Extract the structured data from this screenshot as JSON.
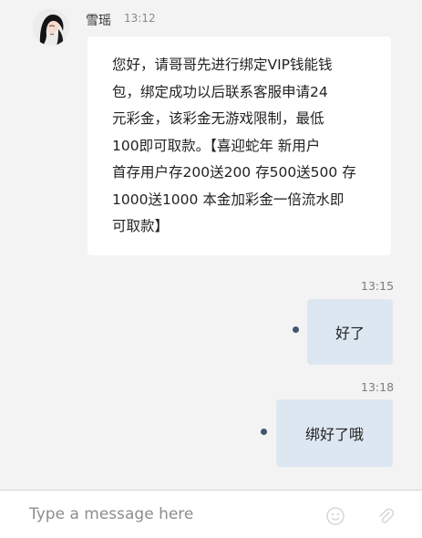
{
  "chat": {
    "incoming": {
      "sender_name": "雪瑶",
      "time": "13:12",
      "text": "您好，请哥哥先进行绑定VIP钱能钱\n包，绑定成功以后联系客服申请24\n元彩金，该彩金无游戏限制，最低\n100即可取款。【喜迎蛇年 新用户\n首存用户存200送200 存500送500 存\n1000送1000 本金加彩金一倍流水即\n可取款】"
    },
    "outgoing": [
      {
        "time": "13:15",
        "text": "好了"
      },
      {
        "time": "13:18",
        "text": "绑好了哦"
      }
    ]
  },
  "composer": {
    "placeholder": "Type a message here"
  },
  "icons": {
    "avatar": "user-avatar",
    "status_dot": "sent-indicator-dot",
    "emoji": "emoji-icon",
    "attach": "attachment-icon"
  }
}
